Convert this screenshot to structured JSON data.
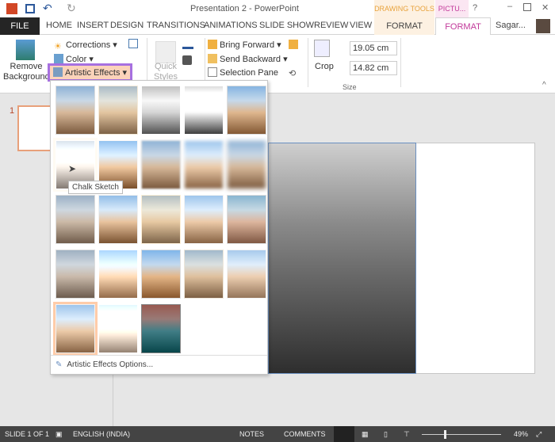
{
  "title": "Presentation 2 - PowerPoint",
  "context_tabs": {
    "drawing_tools": "DRAWING TOOLS",
    "picture_tools": "PICTU..."
  },
  "tabs": [
    "FILE",
    "HOME",
    "INSERT",
    "DESIGN",
    "TRANSITIONS",
    "ANIMATIONS",
    "SLIDE SHOW",
    "REVIEW",
    "VIEW",
    "FORMAT",
    "FORMAT"
  ],
  "user": "Sagar...",
  "ribbon": {
    "remove_bg": "Remove Background",
    "corrections": "Corrections",
    "color": "Color",
    "artistic": "Artistic Effects",
    "quick_styles": "Quick Styles",
    "bring_forward": "Bring Forward",
    "send_backward": "Send Backward",
    "selection_pane": "Selection Pane",
    "crop": "Crop",
    "height": "19.05 cm",
    "width": "14.82 cm",
    "size_group": "Size"
  },
  "gallery": {
    "tooltip": "Chalk Sketch",
    "options": "Artistic Effects Options...",
    "hovered": "Chalk Sketch"
  },
  "slide_number": "1",
  "status": {
    "slide": "SLIDE 1 OF 1",
    "language": "ENGLISH (INDIA)",
    "notes": "NOTES",
    "comments": "COMMENTS",
    "zoom": "49%"
  },
  "colors": {
    "accent": "#b7472a",
    "highlight": "#a770e0",
    "context_drawing": "#e8a33d",
    "context_picture": "#c2399a"
  }
}
